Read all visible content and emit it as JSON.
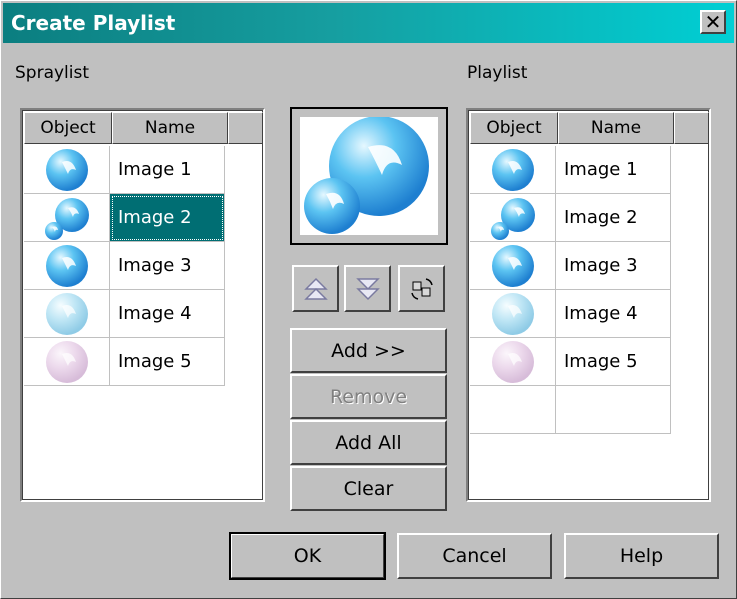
{
  "window": {
    "title": "Create Playlist",
    "close_label": "✕"
  },
  "spraylist": {
    "label": "Spraylist",
    "columns": [
      "Object",
      "Name"
    ],
    "rows": [
      {
        "name": "Image 1",
        "icon": "sphere-blue-icon"
      },
      {
        "name": "Image 2",
        "icon": "double-sphere-icon",
        "selected": true
      },
      {
        "name": "Image 3",
        "icon": "sphere-blue-icon"
      },
      {
        "name": "Image 4",
        "icon": "sphere-light-blue-icon"
      },
      {
        "name": "Image 5",
        "icon": "sphere-pink-icon"
      }
    ]
  },
  "playlist": {
    "label": "Playlist",
    "columns": [
      "Object",
      "Name"
    ],
    "rows": [
      {
        "name": "Image 1",
        "icon": "sphere-blue-icon"
      },
      {
        "name": "Image 2",
        "icon": "double-sphere-icon"
      },
      {
        "name": "Image 3",
        "icon": "sphere-blue-icon"
      },
      {
        "name": "Image 4",
        "icon": "sphere-light-blue-icon"
      },
      {
        "name": "Image 5",
        "icon": "sphere-pink-icon"
      }
    ]
  },
  "preview": {
    "icon": "double-sphere-preview-icon"
  },
  "tools": {
    "move_up_icon": "move-up-icon",
    "move_down_icon": "move-down-icon",
    "shuffle_icon": "shuffle-icon"
  },
  "actions": {
    "add": "Add >>",
    "remove": "Remove",
    "add_all": "Add All",
    "clear": "Clear"
  },
  "footer": {
    "ok": "OK",
    "cancel": "Cancel",
    "help": "Help"
  },
  "colors": {
    "title_start": "#0b7e80",
    "title_end": "#00cfd4",
    "selection": "#006e73",
    "face": "#c0c0c0"
  }
}
